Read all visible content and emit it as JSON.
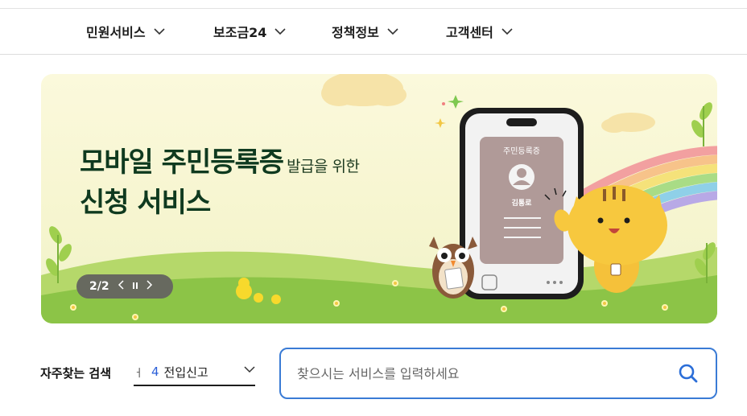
{
  "nav": {
    "items": [
      {
        "label": "민원서비스"
      },
      {
        "label": "보조금24"
      },
      {
        "label": "정책정보"
      },
      {
        "label": "고객센터"
      }
    ]
  },
  "banner": {
    "title_line1": "모바일 주민등록증",
    "title_line1_small": "발급을 위한",
    "title_line2": "신청 서비스",
    "phone_card_title": "주민등록증",
    "phone_card_name": "김통로",
    "pager": {
      "current": "2",
      "separator": "/",
      "total": "2"
    }
  },
  "favorites": {
    "label": "자주찾는 검색",
    "mark": "ㅓ",
    "selected_number": "4",
    "selected_label": "전입신고"
  },
  "search": {
    "placeholder": "찾으시는 서비스를 입력하세요"
  },
  "colors": {
    "accent_blue": "#3a7bd5",
    "banner_title": "#0f3a1f",
    "banner_bg": "#f6f5cf"
  }
}
